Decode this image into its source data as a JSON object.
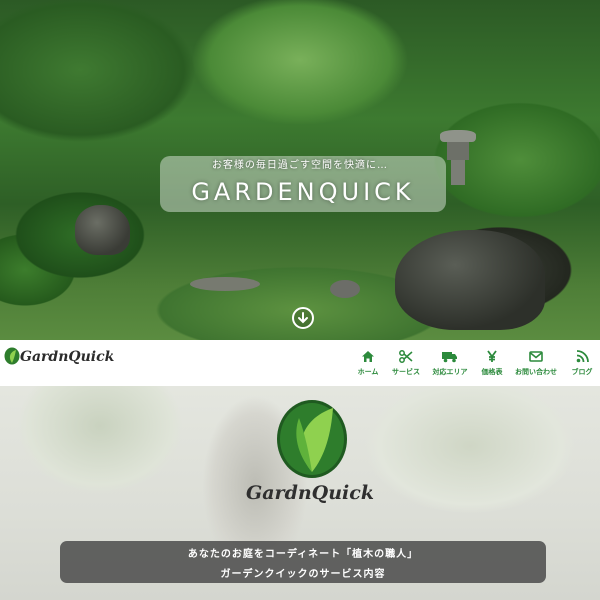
{
  "hero": {
    "tagline": "お客様の毎日過ごす空間を快適に…",
    "title": "GARDENQUICK",
    "scroll_icon": "arrow-down-circle-icon"
  },
  "header": {
    "logo_text": "GardnQuick",
    "logo_icon": "leaf-icon"
  },
  "nav": {
    "items": [
      {
        "label": "ホーム",
        "icon": "home-icon"
      },
      {
        "label": "サービス",
        "icon": "scissors-icon"
      },
      {
        "label": "対応エリア",
        "icon": "truck-icon"
      },
      {
        "label": "価格表",
        "icon": "yen-icon"
      },
      {
        "label": "お問い合わせ",
        "icon": "mail-icon"
      },
      {
        "label": "ブログ",
        "icon": "rss-icon"
      }
    ],
    "accent_color": "#2c8a3c"
  },
  "main": {
    "logo_text": "GardnQuick",
    "banner_line1": "あなたのお庭をコーディネート「植木の職人」",
    "banner_line2": "ガーデンクイックのサービス内容"
  }
}
